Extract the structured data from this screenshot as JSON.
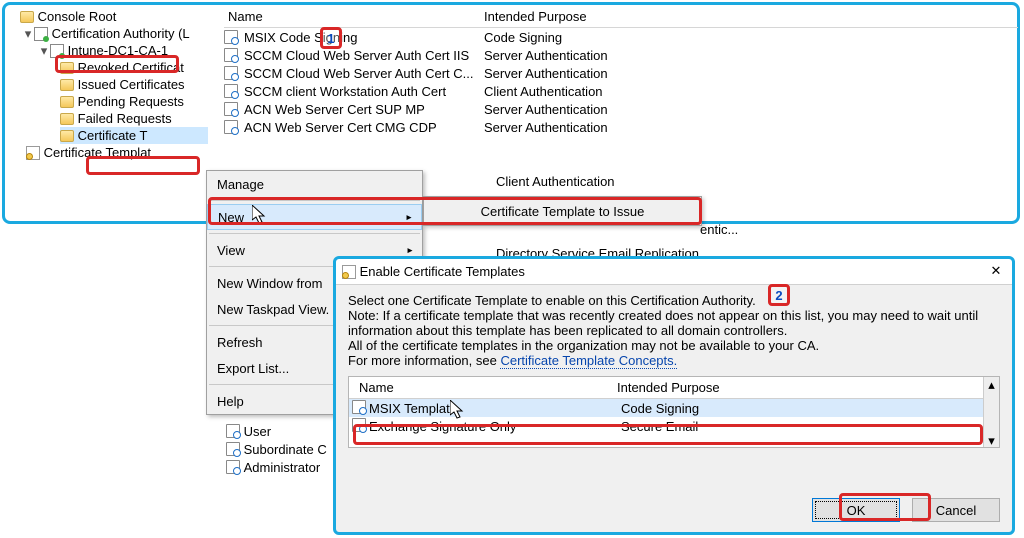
{
  "tree": {
    "root": "Console Root",
    "ca": "Certification Authority (L",
    "server": "Intune-DC1-CA-1",
    "nodes": {
      "revoked": "Revoked Certificat",
      "issued": "Issued Certificates",
      "pending": "Pending Requests",
      "failed": "Failed Requests",
      "templatesShort": "Certificate T"
    },
    "templates": "Certificate Templat"
  },
  "cols": {
    "name": "Name",
    "purpose": "Intended Purpose"
  },
  "rows": [
    {
      "name": "MSIX Code Signing",
      "purpose": "Code Signing"
    },
    {
      "name": "SCCM Cloud Web Server Auth Cert IIS",
      "purpose": "Server Authentication"
    },
    {
      "name": "SCCM Cloud Web Server Auth Cert C...",
      "purpose": "Server Authentication"
    },
    {
      "name": "SCCM client Workstation Auth Cert",
      "purpose": "Client Authentication"
    },
    {
      "name": "ACN Web Server Cert SUP MP",
      "purpose": "Server Authentication"
    },
    {
      "name": "ACN Web Server Cert CMG CDP",
      "purpose": "Server Authentication"
    }
  ],
  "hiddenRows": [
    {
      "purpose": "Client Authentication"
    },
    {
      "purpose": "entic..."
    },
    {
      "purpose": "Directory Service Email Replication"
    }
  ],
  "context": {
    "manage": "Manage",
    "new": "New",
    "view": "View",
    "newWindow": "New Window from",
    "newTask": "New Taskpad View.",
    "refresh": "Refresh",
    "export": "Export List...",
    "help": "Help"
  },
  "submenu": {
    "issue": "Certificate Template to Issue"
  },
  "extra": {
    "user": "User",
    "subordinate": "Subordinate C",
    "admin": "Administrator"
  },
  "dialog": {
    "title": "Enable Certificate Templates",
    "msg1": "Select one Certificate Template to enable on this Certification Authority.",
    "msg2a": "Note: If a certificate template that was recently created does not appear on this list, you may need to wait until",
    "msg2b": "information about this template has been replicated to all domain controllers.",
    "msg3": "All of the certificate templates in the organization may not be available to your CA.",
    "msg4Pre": "For more information, see",
    "msg4Link": "Certificate Template Concepts.",
    "colName": "Name",
    "colPurpose": "Intended Purpose",
    "items": [
      {
        "name": "MSIX Template",
        "purpose": "Code Signing",
        "sel": true
      },
      {
        "name": "Exchange Signature Only",
        "purpose": "Secure Email",
        "sel": false
      }
    ],
    "ok": "OK",
    "cancel": "Cancel"
  },
  "badges": {
    "one": "1",
    "two": "2"
  }
}
